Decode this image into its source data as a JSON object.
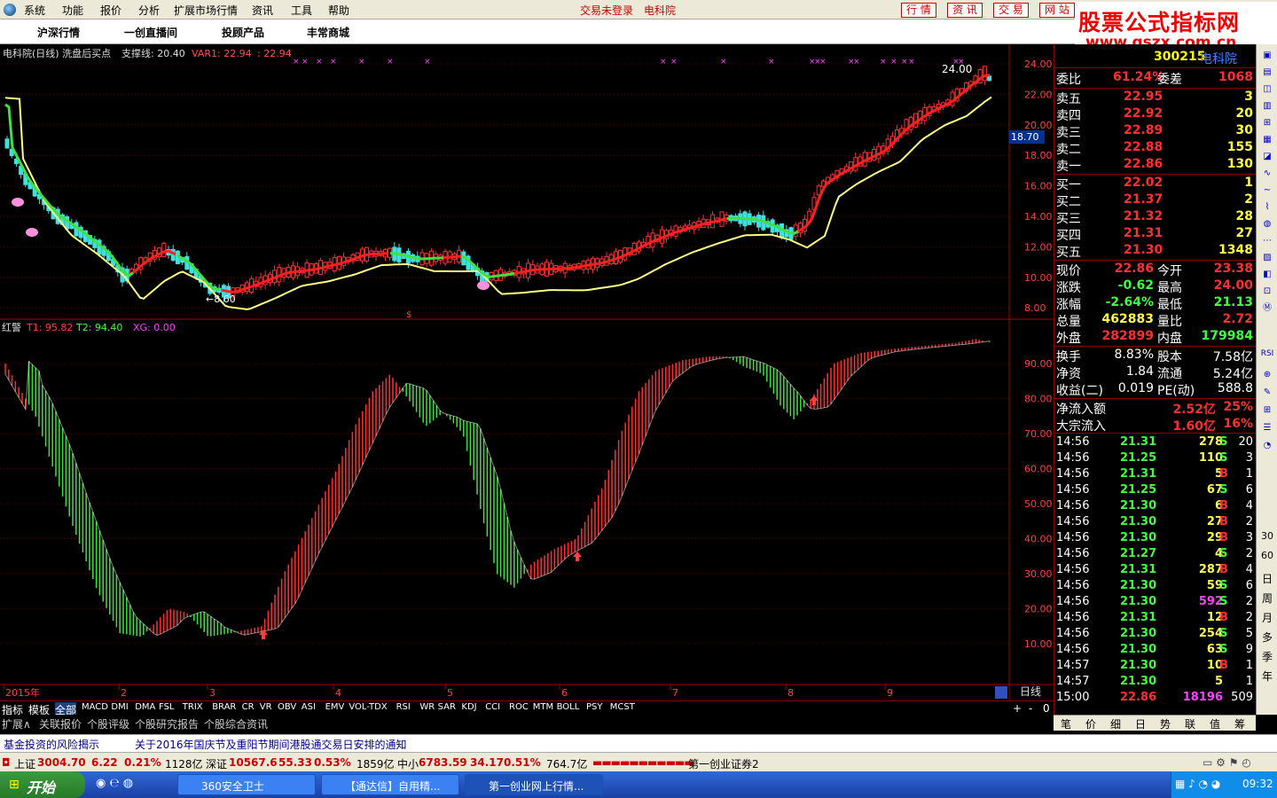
{
  "menubar": {
    "items": [
      "系统",
      "功能",
      "报价",
      "分析",
      "扩展市场行情",
      "资讯",
      "工具",
      "帮助"
    ],
    "center_status": "交易未登录",
    "center_app": "电科院",
    "buttons": [
      "行 情",
      "资 讯",
      "交 易",
      "网 站"
    ]
  },
  "toolbar": {
    "items": [
      "沪深行情",
      "一创直播间",
      "投顾产品",
      "丰常商城"
    ]
  },
  "logo": {
    "line1": "股票公式指标网",
    "line2": "www.gszx.com.cn"
  },
  "chart": {
    "header": {
      "title": "电科院(日线) 洗盘后买点",
      "support_label": "支撑线: 20.40",
      "var1_label": "VAR1: 22.94",
      "var_label": ": 22.94"
    },
    "price_labels": [
      "24.00",
      "22.00",
      "20.00",
      "18.00",
      "16.00",
      "14.00",
      "12.00",
      "10.00",
      "8.00"
    ],
    "current_price_tag": "18.70",
    "high_annotation": "24.00",
    "low_annotation": "8.60",
    "indicator": {
      "name": "红警",
      "t1": "T1: 95.82",
      "t2": "T2: 94.40",
      "xg": "XG: 0.00"
    },
    "ind_labels": [
      "90.00",
      "80.00",
      "70.00",
      "60.00",
      "50.00",
      "40.00",
      "30.00",
      "20.00",
      "10.00"
    ],
    "time_labels": [
      "2015年",
      "2",
      "3",
      "4",
      "5",
      "6",
      "7",
      "8",
      "9"
    ],
    "period": "日线",
    "colors": {
      "up": "#ff3030",
      "down": "#00d000",
      "ma_green": "#40e040",
      "ma_yellow": "#ffff80",
      "grid": "#800000",
      "bg": "#000000"
    }
  },
  "indicator_tabs": [
    "指标",
    "模板",
    "全部",
    "MACD",
    "DMI",
    "DMA",
    "FSL",
    "TRIX",
    "BRAR",
    "CR",
    "VR",
    "OBV",
    "ASI",
    "EMV",
    "VOL-TDX",
    "RSI",
    "WR",
    "SAR",
    "KDJ",
    "CCI",
    "ROC",
    "MTM",
    "BOLL",
    "PSY",
    "MCST"
  ],
  "ext_tabs": [
    "扩展∧",
    "关联报价",
    "个股评级",
    "个股研究报告",
    "个股综合资讯"
  ],
  "zoom": {
    "plus": "+",
    "minus": "-",
    "zero": "0"
  },
  "panel": {
    "code": "300215",
    "name": "电科院",
    "weibi": {
      "label": "委比",
      "value": "61.24%",
      "diff_label": "委差",
      "diff": "1068"
    },
    "sell": [
      {
        "label": "卖五",
        "price": "22.95",
        "vol": "3"
      },
      {
        "label": "卖四",
        "price": "22.92",
        "vol": "20"
      },
      {
        "label": "卖三",
        "price": "22.89",
        "vol": "30"
      },
      {
        "label": "卖二",
        "price": "22.88",
        "vol": "155"
      },
      {
        "label": "卖一",
        "price": "22.86",
        "vol": "130"
      }
    ],
    "buy": [
      {
        "label": "买一",
        "price": "22.02",
        "vol": "1"
      },
      {
        "label": "买二",
        "price": "21.37",
        "vol": "2"
      },
      {
        "label": "买三",
        "price": "21.32",
        "vol": "28"
      },
      {
        "label": "买四",
        "price": "21.31",
        "vol": "27"
      },
      {
        "label": "买五",
        "price": "21.30",
        "vol": "1348"
      }
    ],
    "stats": [
      {
        "l1": "现价",
        "v1": "22.86",
        "l2": "今开",
        "v2": "23.38"
      },
      {
        "l1": "涨跌",
        "v1": "-0.62",
        "l2": "最高",
        "v2": "24.00"
      },
      {
        "l1": "涨幅",
        "v1": "-2.64%",
        "l2": "最低",
        "v2": "21.13"
      },
      {
        "l1": "总量",
        "v1": "462883",
        "l2": "量比",
        "v2": "2.72"
      },
      {
        "l1": "外盘",
        "v1": "282899",
        "l2": "内盘",
        "v2": "179984"
      }
    ],
    "stats2": [
      {
        "l1": "换手",
        "v1": "8.83%",
        "l2": "股本",
        "v2": "7.58亿"
      },
      {
        "l1": "净资",
        "v1": "1.84",
        "l2": "流通",
        "v2": "5.24亿"
      },
      {
        "l1": "收益(二)",
        "v1": "0.019",
        "l2": "PE(动)",
        "v2": "588.8"
      }
    ],
    "flow": [
      {
        "label": "净流入额",
        "value": "2.52亿",
        "pct": "25%"
      },
      {
        "label": "大宗流入",
        "value": "1.60亿",
        "pct": "16%"
      }
    ],
    "ticks": [
      {
        "t": "14:56",
        "p": "21.31",
        "v": "278",
        "s": "S",
        "n": "20"
      },
      {
        "t": "14:56",
        "p": "21.25",
        "v": "110",
        "s": "S",
        "n": "3"
      },
      {
        "t": "14:56",
        "p": "21.31",
        "v": "5",
        "s": "B",
        "n": "1"
      },
      {
        "t": "14:56",
        "p": "21.25",
        "v": "67",
        "s": "S",
        "n": "6"
      },
      {
        "t": "14:56",
        "p": "21.30",
        "v": "6",
        "s": "B",
        "n": "4"
      },
      {
        "t": "14:56",
        "p": "21.30",
        "v": "27",
        "s": "B",
        "n": "2"
      },
      {
        "t": "14:56",
        "p": "21.30",
        "v": "29",
        "s": "B",
        "n": "3"
      },
      {
        "t": "14:56",
        "p": "21.27",
        "v": "4",
        "s": "S",
        "n": "2"
      },
      {
        "t": "14:56",
        "p": "21.31",
        "v": "287",
        "s": "B",
        "n": "4"
      },
      {
        "t": "14:56",
        "p": "21.30",
        "v": "59",
        "s": "S",
        "n": "6"
      },
      {
        "t": "14:56",
        "p": "21.30",
        "v": "592",
        "s": "S",
        "n": "2"
      },
      {
        "t": "14:56",
        "p": "21.31",
        "v": "12",
        "s": "B",
        "n": "2"
      },
      {
        "t": "14:56",
        "p": "21.30",
        "v": "254",
        "s": "S",
        "n": "5"
      },
      {
        "t": "14:56",
        "p": "21.30",
        "v": "63",
        "s": "S",
        "n": "9"
      },
      {
        "t": "14:57",
        "p": "21.30",
        "v": "10",
        "s": "B",
        "n": "1"
      },
      {
        "t": "14:57",
        "p": "21.30",
        "v": "5",
        "s": "",
        "n": "1"
      },
      {
        "t": "15:00",
        "p": "22.86",
        "v": "18196",
        "s": "",
        "n": "509"
      }
    ]
  },
  "bottom_tabs": [
    "笔",
    "价",
    "细",
    "日",
    "势",
    "联",
    "值",
    "筹"
  ],
  "sidebar": {
    "labels": [
      "RSI",
      "日",
      "周",
      "月",
      "多",
      "季",
      "年"
    ],
    "values": [
      "30",
      "60"
    ]
  },
  "news": [
    "基金投资的风险揭示",
    "关于2016年国庆节及重阳节期间港股通交易日安排的通知"
  ],
  "status": {
    "sh_label": "上证",
    "sh_val": "3004.70",
    "sh_chg": "6.22",
    "sh_pct": "0.21%",
    "sh_amt": "1128亿",
    "sz_label": "深证",
    "sz_val": "10567.6",
    "sz_chg": "55.33",
    "sz_pct": "0.53%",
    "sz_amt": "1859亿",
    "zx_label": "中小",
    "zx_val": "6783.59",
    "zx_chg": "34.17",
    "zx_pct": "0.51%",
    "zx_amt": "764.7亿",
    "broker": "第一创业证券2"
  },
  "taskbar": {
    "start": "开始",
    "tasks": [
      "360安全卫士",
      "【通达信】自用精...",
      "第一创业网上行情..."
    ],
    "clock": "09:32"
  }
}
